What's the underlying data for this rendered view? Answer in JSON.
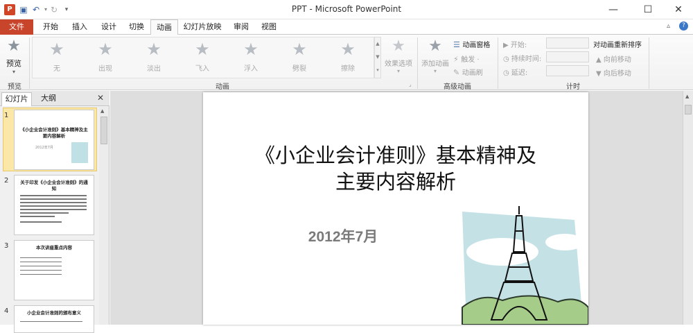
{
  "window": {
    "title": "PPT - Microsoft PowerPoint",
    "app_icon": "P",
    "min": "—",
    "max": "☐",
    "close": "✕"
  },
  "tabs": [
    "文件",
    "开始",
    "插入",
    "设计",
    "切换",
    "动画",
    "幻灯片放映",
    "审阅",
    "视图"
  ],
  "ribbon": {
    "preview": {
      "label": "预览",
      "group": "预览"
    },
    "animations": [
      "无",
      "出现",
      "淡出",
      "飞入",
      "浮入",
      "劈裂",
      "擦除"
    ],
    "effect_options": "效果选项",
    "animation_group": "动画",
    "advanced": {
      "add": "添加动画",
      "pane": "动画窗格",
      "trigger": "触发 ·",
      "painter": "动画刷",
      "group": "高级动画"
    },
    "timing": {
      "start": "开始:",
      "duration": "持续时间:",
      "delay": "延迟:",
      "group": "计时",
      "reorder": "对动画重新排序",
      "earlier": "向前移动",
      "later": "向后移动"
    }
  },
  "panel": {
    "tabs": [
      "幻灯片",
      "大纲"
    ],
    "close": "✕"
  },
  "thumbs": [
    {
      "num": "1",
      "title": "《小企业会计准则》基本精神及主要内容解析",
      "sub": "2012年7月"
    },
    {
      "num": "2",
      "title": "关于印发《小企业会计准则》的通知"
    },
    {
      "num": "3",
      "title": "本次讲座重点内容"
    },
    {
      "num": "4",
      "title": "小企业会计准则的颁布意义"
    }
  ],
  "slide": {
    "title_line1": "《小企业会计准则》基本精神及",
    "title_line2": "主要内容解析",
    "subtitle": "2012年7月"
  },
  "colors": {
    "file_tab": "#c8442b",
    "accent": "#3a63a8"
  }
}
